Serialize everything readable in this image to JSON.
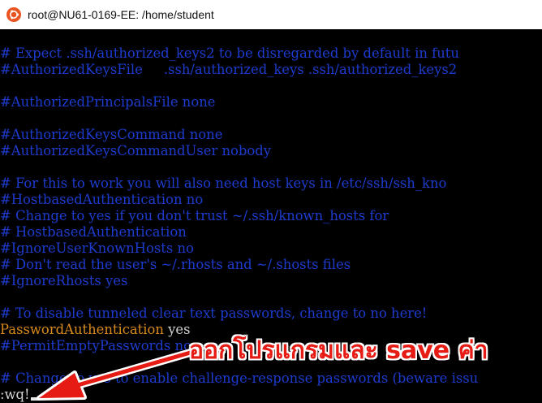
{
  "window": {
    "title": "root@NU61-0169-EE: /home/student",
    "icon": "ubuntu-terminal-icon"
  },
  "terminal": {
    "lines": [
      {
        "text": "# Expect .ssh/authorized_keys2 to be disregarded by default in futu"
      },
      {
        "text": "#AuthorizedKeysFile     .ssh/authorized_keys .ssh/authorized_keys2"
      },
      {
        "text": ""
      },
      {
        "text": "#AuthorizedPrincipalsFile none"
      },
      {
        "text": ""
      },
      {
        "text": "#AuthorizedKeysCommand none"
      },
      {
        "text": "#AuthorizedKeysCommandUser nobody"
      },
      {
        "text": ""
      },
      {
        "text": "# For this to work you will also need host keys in /etc/ssh/ssh_kno"
      },
      {
        "text": "#HostbasedAuthentication no"
      },
      {
        "text": "# Change to yes if you don't trust ~/.ssh/known_hosts for"
      },
      {
        "text": "# HostbasedAuthentication"
      },
      {
        "text": "#IgnoreUserKnownHosts no"
      },
      {
        "text": "# Don't read the user's ~/.rhosts and ~/.shosts files"
      },
      {
        "text": "#IgnoreRhosts yes"
      },
      {
        "text": ""
      },
      {
        "text": "# To disable tunneled clear text passwords, change to no here!"
      },
      {
        "text": "yes",
        "keyword": "PasswordAuthentication"
      },
      {
        "text": "#PermitEmptyPasswords no"
      },
      {
        "text": ""
      },
      {
        "text": "# Change to yes to enable challenge-response passwords (beware issu"
      }
    ],
    "command_line": ":wq!",
    "colors": {
      "comment": "#1d3ccf",
      "keyword": "#d98a1a",
      "text": "#d4d4d4"
    }
  },
  "annotation": {
    "text": "ออกโปรแกรมและ save ค่า",
    "color": "#e51b14"
  }
}
